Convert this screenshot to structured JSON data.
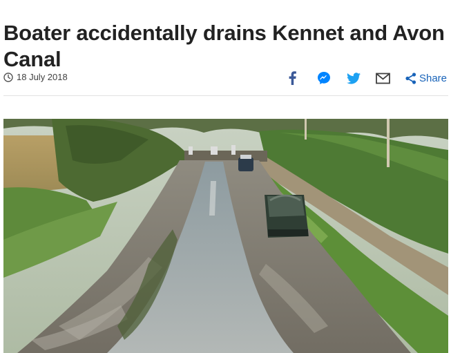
{
  "article": {
    "headline": "Boater accidentally drains Kennet and Avon Canal",
    "date": "18 July 2018"
  },
  "share": {
    "label": "Share",
    "icons": [
      "facebook-icon",
      "messenger-icon",
      "twitter-icon",
      "email-icon",
      "share-icon"
    ]
  },
  "colors": {
    "text": "#222222",
    "share_blue": "#1863b9",
    "facebook": "#3b5998",
    "messenger": "#0084ff",
    "twitter": "#1da1f2",
    "email": "#404040"
  }
}
